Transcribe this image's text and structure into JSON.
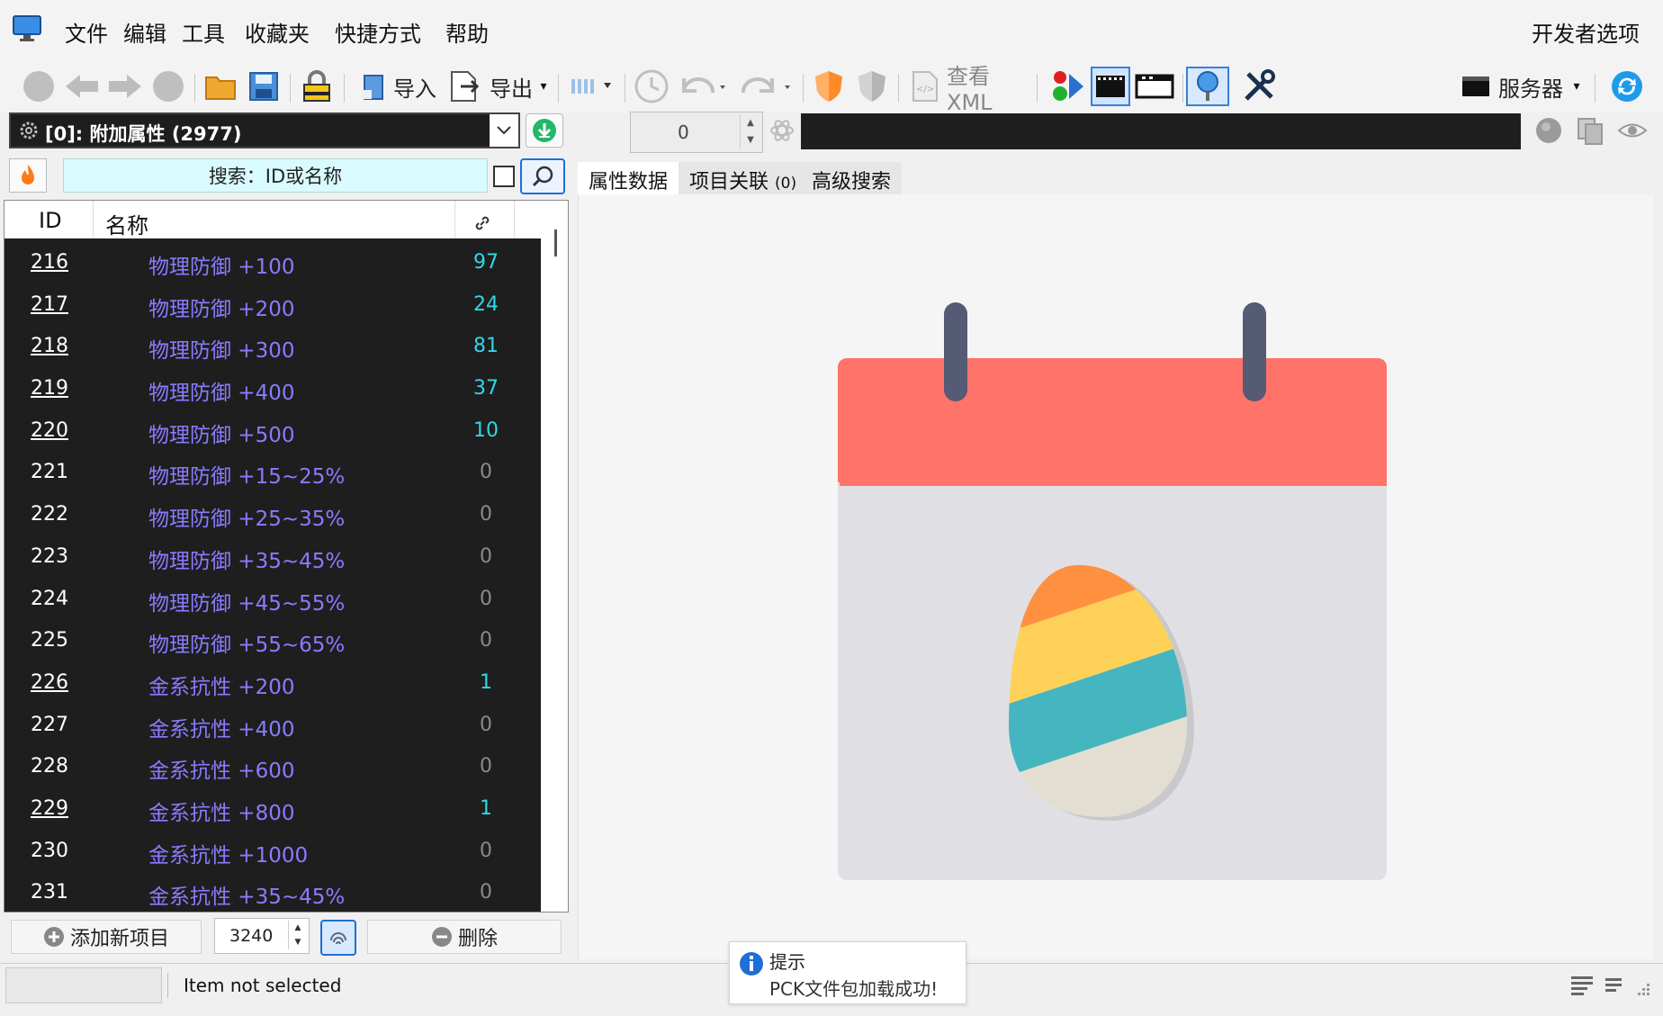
{
  "menu": {
    "file": "文件",
    "edit": "编辑",
    "tools": "工具",
    "favorites": "收藏夹",
    "shortcuts": "快捷方式",
    "help": "帮助",
    "developer_options": "开发者选项"
  },
  "toolbar": {
    "import_label": "导入",
    "export_label": "导出",
    "view_xml_label": "查看XML",
    "server_label": "服务器"
  },
  "selector": {
    "value": "[0]: 附加属性 (2977)"
  },
  "spinner": {
    "value": "0"
  },
  "search": {
    "label": "搜索：ID或名称"
  },
  "tabs": [
    {
      "label": "属性数据"
    },
    {
      "label": "项目关联",
      "badge": "(0)"
    },
    {
      "label": "高级搜索"
    }
  ],
  "table": {
    "headers": {
      "id": "ID",
      "name": "名称"
    },
    "rows": [
      {
        "id": "216",
        "name": "物理防御 +100",
        "count": "97",
        "linked": true
      },
      {
        "id": "217",
        "name": "物理防御 +200",
        "count": "24",
        "linked": true
      },
      {
        "id": "218",
        "name": "物理防御 +300",
        "count": "81",
        "linked": true
      },
      {
        "id": "219",
        "name": "物理防御 +400",
        "count": "37",
        "linked": true
      },
      {
        "id": "220",
        "name": "物理防御 +500",
        "count": "10",
        "linked": true
      },
      {
        "id": "221",
        "name": "物理防御 +15~25%",
        "count": "0",
        "linked": false
      },
      {
        "id": "222",
        "name": "物理防御 +25~35%",
        "count": "0",
        "linked": false
      },
      {
        "id": "223",
        "name": "物理防御 +35~45%",
        "count": "0",
        "linked": false
      },
      {
        "id": "224",
        "name": "物理防御 +45~55%",
        "count": "0",
        "linked": false
      },
      {
        "id": "225",
        "name": "物理防御 +55~65%",
        "count": "0",
        "linked": false
      },
      {
        "id": "226",
        "name": "金系抗性 +200",
        "count": "1",
        "linked": true
      },
      {
        "id": "227",
        "name": "金系抗性 +400",
        "count": "0",
        "linked": false
      },
      {
        "id": "228",
        "name": "金系抗性 +600",
        "count": "0",
        "linked": false
      },
      {
        "id": "229",
        "name": "金系抗性 +800",
        "count": "1",
        "linked": true
      },
      {
        "id": "230",
        "name": "金系抗性 +1000",
        "count": "0",
        "linked": false
      },
      {
        "id": "231",
        "name": "金系抗性 +35~45%",
        "count": "0",
        "linked": false
      }
    ]
  },
  "bottom": {
    "add_label": "添加新项目",
    "quantity": "3240",
    "delete_label": "删除"
  },
  "status": {
    "text": "Item not selected"
  },
  "toast": {
    "title": "提示",
    "message": "PCK文件包加载成功!"
  },
  "colors": {
    "accent": "#1e6fd8",
    "row_name": "#8a7bff",
    "count_highlight": "#2fd8e8",
    "calendar_red": "#ff7369",
    "calendar_body": "#e0e0e4"
  }
}
